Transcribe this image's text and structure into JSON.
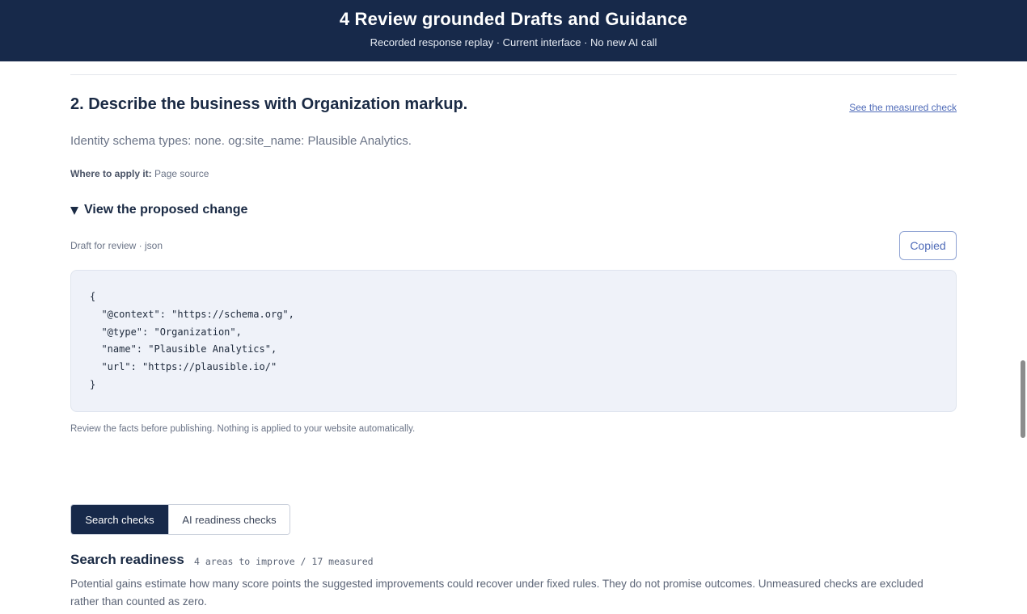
{
  "banner": {
    "title": "4 Review grounded Drafts and Guidance",
    "subtitle": "Recorded response replay · Current interface · No new AI call"
  },
  "step": {
    "title": "2. Describe the business with Organization markup.",
    "link": "See the measured check",
    "finding": "Identity schema types: none. og:site_name: Plausible Analytics.",
    "apply_label": "Where to apply it:",
    "apply_value": "Page source"
  },
  "disclosure": {
    "label": "View the proposed change",
    "draft_label": "Draft for review · json",
    "copy_button": "Copied"
  },
  "code": {
    "lines": [
      "{",
      "  \"@context\": \"https://schema.org\",",
      "  \"@type\": \"Organization\",",
      "  \"name\": \"Plausible Analytics\",",
      "  \"url\": \"https://plausible.io/\"",
      "}"
    ]
  },
  "disclaimer": "Review the facts before publishing. Nothing is applied to your website automatically.",
  "tabs": {
    "active": "Search checks",
    "inactive": "AI readiness checks"
  },
  "readiness": {
    "title": "Search readiness",
    "meta": "4 areas to improve / 17 measured",
    "explanation": "Potential gains estimate how many score points the suggested improvements could recover under fixed rules. They do not promise outcomes. Unmeasured checks are excluded rather than counted as zero."
  }
}
